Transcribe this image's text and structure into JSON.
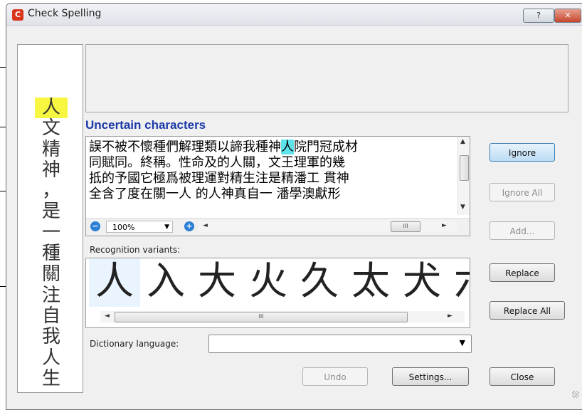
{
  "window": {
    "title": "Check Spelling",
    "help_label": "?",
    "close_label": "✕"
  },
  "vertical_text": [
    "人",
    "文",
    "精",
    "神",
    "，",
    "是",
    "一",
    "種",
    "關",
    "注",
    "自",
    "我",
    "人",
    "生"
  ],
  "highlight_index": 0,
  "uncertain_label": "Uncertain characters",
  "text_lines": [
    {
      "before": "誤不被不懷種們解理類以諦我種神",
      "hl": "人",
      "after": "院門冠成材"
    },
    {
      "before": "同賦同。終稱。性命及的人關，文王理軍的幾",
      "hl": "",
      "after": ""
    },
    {
      "before": "抵的予國它極爲被理運對精生注是精潘工 貫神",
      "hl": "",
      "after": ""
    },
    {
      "before": "全含了度在關一人 的人神真自一 潘學澳獻形",
      "hl": "",
      "after": ""
    }
  ],
  "zoom": {
    "value": "100%",
    "minus_label": "−",
    "plus_label": "+"
  },
  "scroll_thumb_label": "III",
  "variants_label": "Recognition variants:",
  "variants": [
    "人",
    "入",
    "大",
    "火",
    "久",
    "太",
    "犬",
    "六"
  ],
  "selected_variant": 0,
  "dictionary_label": "Dictionary language:",
  "dictionary_value": "",
  "buttons": {
    "ignore": "Ignore",
    "ignore_all": "Ignore All",
    "add": "Add...",
    "replace": "Replace",
    "replace_all": "Replace All",
    "undo": "Undo",
    "settings": "Settings...",
    "close": "Close"
  }
}
